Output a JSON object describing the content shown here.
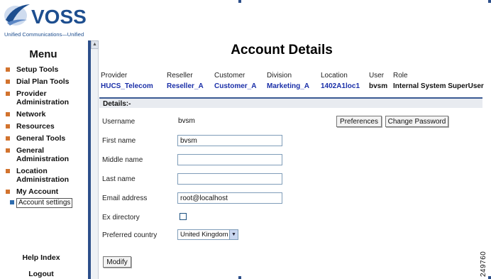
{
  "brand": {
    "name": "VOSS",
    "tagline": "Unified Communications—Unified"
  },
  "sidebar": {
    "menu_title": "Menu",
    "items": [
      {
        "label": "Setup Tools"
      },
      {
        "label": "Dial Plan Tools"
      },
      {
        "label": "Provider Administration"
      },
      {
        "label": "Network"
      },
      {
        "label": "Resources"
      },
      {
        "label": "General Tools"
      },
      {
        "label": "General Administration"
      },
      {
        "label": "Location Administration"
      },
      {
        "label": "My Account"
      }
    ],
    "sub_item": {
      "label": "Account settings"
    },
    "help_label": "Help Index",
    "logout_label": "Logout"
  },
  "page": {
    "title": "Account Details"
  },
  "hierarchy": {
    "headers": [
      "Provider",
      "Reseller",
      "Customer",
      "Division",
      "Location",
      "User",
      "Role"
    ],
    "values": [
      "HUCS_Telecom",
      "Reseller_A",
      "Customer_A",
      "Marketing_A",
      "1402A1loc1",
      "bvsm",
      "Internal System SuperUser"
    ]
  },
  "details": {
    "section_label": "Details:-",
    "username_label": "Username",
    "username_value": "bvsm",
    "first_name_label": "First name",
    "first_name_value": "bvsm",
    "middle_name_label": "Middle name",
    "middle_name_value": "",
    "last_name_label": "Last name",
    "last_name_value": "",
    "email_label": "Email address",
    "email_value": "root@localhost",
    "ex_directory_label": "Ex directory",
    "ex_directory_checked": false,
    "country_label": "Preferred country",
    "country_value": "United Kingdom"
  },
  "buttons": {
    "preferences": "Preferences",
    "change_password": "Change Password",
    "modify": "Modify"
  },
  "figure_id": "249760",
  "colors": {
    "brand_blue": "#1d4e8f",
    "menu_bullet": "#d2732e",
    "link_blue": "#1a2fa8",
    "frame_blue": "#2d4f8a"
  }
}
